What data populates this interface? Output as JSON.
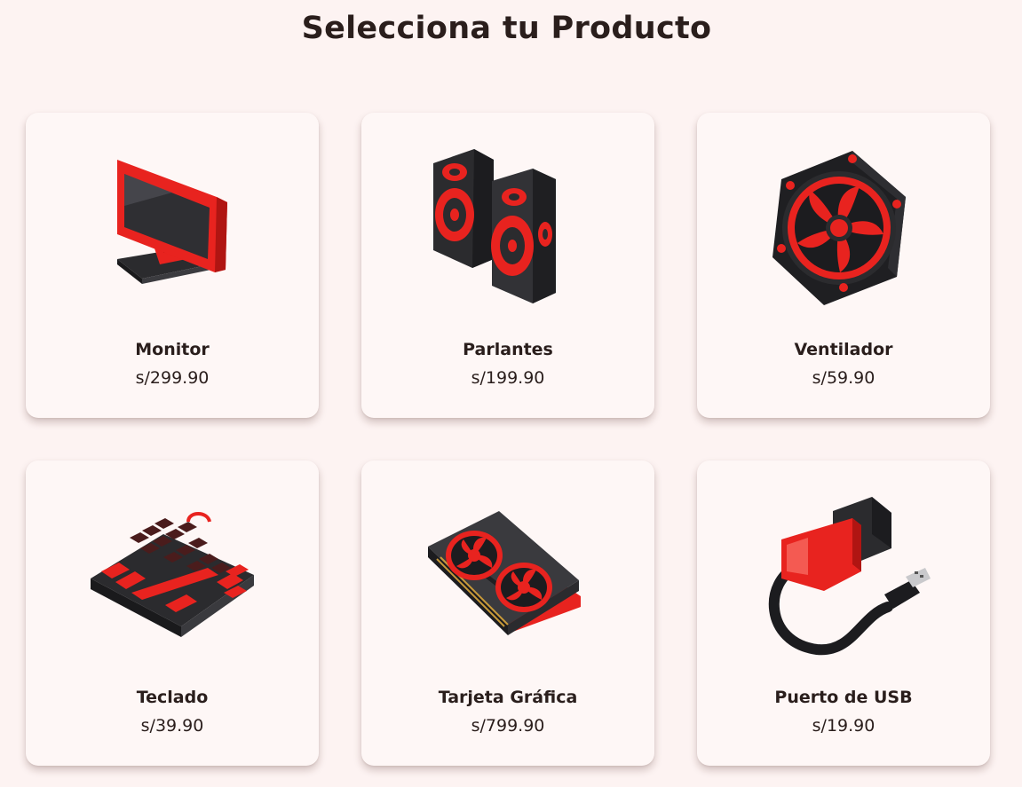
{
  "page": {
    "title": "Selecciona tu Producto"
  },
  "products": [
    {
      "name": "Monitor",
      "price": "s/299.90",
      "icon": "monitor-icon"
    },
    {
      "name": "Parlantes",
      "price": "s/199.90",
      "icon": "speakers-icon"
    },
    {
      "name": "Ventilador",
      "price": "s/59.90",
      "icon": "fan-icon"
    },
    {
      "name": "Teclado",
      "price": "s/39.90",
      "icon": "keyboard-icon"
    },
    {
      "name": "Tarjeta Gráfica",
      "price": "s/799.90",
      "icon": "graphics-card-icon"
    },
    {
      "name": "Puerto de USB",
      "price": "s/19.90",
      "icon": "usb-port-icon"
    }
  ],
  "colors": {
    "background": "#fdf3f2",
    "card": "#fef7f6",
    "accent_red": "#e8231f",
    "dark": "#2b2b2e",
    "text": "#2a1e1c"
  }
}
